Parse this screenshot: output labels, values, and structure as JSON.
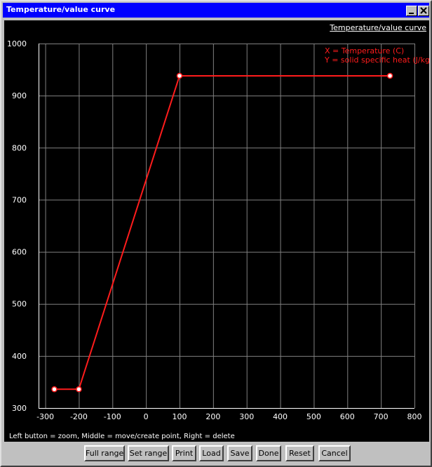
{
  "window": {
    "title": "Temperature/value curve",
    "minimize_icon": "minimize-icon",
    "close_icon": "close-icon"
  },
  "plot": {
    "curve_title": "Temperature/value curve",
    "legend": {
      "x_label": "X = Temperature (C)",
      "y_label": "Y = solid specific heat (J/kg-K)"
    },
    "status_text": "Left button = zoom, Middle = move/create point, Right = delete"
  },
  "chart_data": {
    "type": "line",
    "title": "Temperature/value curve",
    "xlabel": "X = Temperature (C)",
    "ylabel": "Y = solid specific heat (J/kg-K)",
    "xlim": [
      -320,
      800
    ],
    "ylim": [
      300,
      1000
    ],
    "x_ticks": [
      -300,
      -200,
      -100,
      0,
      100,
      200,
      300,
      400,
      500,
      600,
      700,
      800
    ],
    "y_ticks": [
      300,
      400,
      500,
      600,
      700,
      800,
      900,
      1000
    ],
    "grid": true,
    "series": [
      {
        "x": [
          -273,
          -200,
          100,
          727
        ],
        "y": [
          336,
          336,
          938,
          938
        ]
      }
    ],
    "colors": {
      "background": "#000000",
      "grid": "#808080",
      "axes": "#ffffff",
      "line": "#ff1c1c",
      "point_fill": "#ffffff"
    }
  },
  "buttons": {
    "full_range": "Full range",
    "set_range": "Set range",
    "print": "Print",
    "load": "Load",
    "save": "Save",
    "done": "Done",
    "reset": "Reset",
    "cancel": "Cancel"
  }
}
